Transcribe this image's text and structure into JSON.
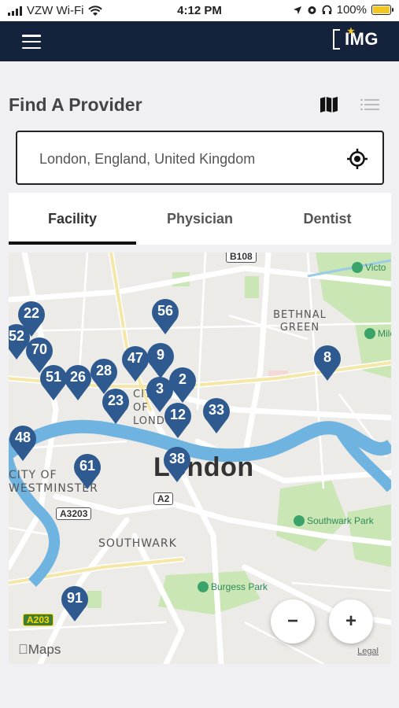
{
  "status_bar": {
    "carrier": "VZW Wi-Fi",
    "time": "4:12 PM",
    "battery": "100%"
  },
  "navbar": {
    "logo_text": "IMG"
  },
  "header": {
    "title": "Find A Provider"
  },
  "search": {
    "value": "London, England, United Kingdom"
  },
  "tabs": [
    {
      "label": "Facility",
      "active": true
    },
    {
      "label": "Physician",
      "active": false
    },
    {
      "label": "Dentist",
      "active": false
    }
  ],
  "map": {
    "city_label": "London",
    "area_labels": {
      "bethnal_green": "BETHNAL GREEN",
      "city_of_westminster": "CITY OF WESTMINSTER",
      "southwark": "SOUTHWARK",
      "city_of_london": "CITY OF LONDON"
    },
    "parks": {
      "victoria_park": "Victo",
      "mile_end": "Mile",
      "southwark_park": "Southwark Park",
      "burgess_park": "Burgess Park"
    },
    "roads": [
      "B108",
      "A2",
      "A3203",
      "A203"
    ],
    "pins": [
      "22",
      "52",
      "70",
      "56",
      "47",
      "9",
      "28",
      "51",
      "26",
      "3",
      "2",
      "23",
      "12",
      "33",
      "8",
      "48",
      "61",
      "38",
      "91"
    ],
    "brand": "Maps",
    "legal": "Legal",
    "zoom_out": "−",
    "zoom_in": "+"
  },
  "colors": {
    "navbar": "#15223c",
    "pin": "#2f5a8f",
    "river": "#6fb4e0",
    "park": "#c9e6b4"
  }
}
